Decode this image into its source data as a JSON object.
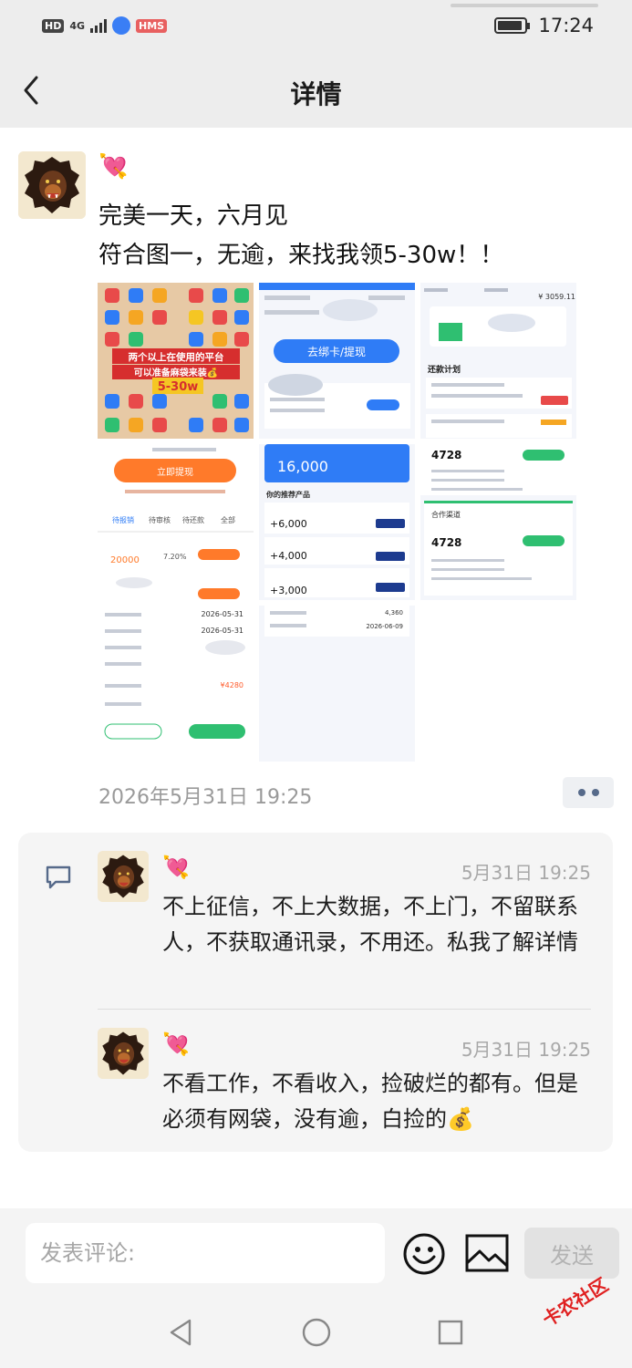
{
  "status_bar": {
    "hd": "HD",
    "network": "4G",
    "hms": "HMS",
    "time": "17:24",
    "icons": [
      "signal-icon",
      "network-icon",
      "battery-icon"
    ]
  },
  "nav": {
    "title": "详情",
    "back_icon": "chevron-left-icon"
  },
  "post": {
    "emoji": "💘",
    "text_line1": "完美一天，六月见",
    "text_line2": "符合图一，无逾，来找我领5-30w！！",
    "timestamp": "2026年5月31日 19:25",
    "images": {
      "img1_overlay1": "两个以上在使用的平台",
      "img1_overlay2": "可以准备麻袋来装💰",
      "img1_overlay3": "5-30w",
      "img2_button": "去绑卡/提现",
      "img3_title": "还款计划",
      "img3_amount1": "¥ 3059.11",
      "img4_button": "立即提现",
      "img4_tabs": [
        "待报销",
        "待审核",
        "待还款",
        "全部"
      ],
      "img4_amount": "20000",
      "img4_rate": "7.20%",
      "img5_amount": "16,000",
      "img5_items": [
        "+6,000",
        "+4,000",
        "+3,000"
      ],
      "img5_header": "你的推荐产品",
      "img6_amount": "4728",
      "img6_subtitle": "合作渠道",
      "img7_date1": "2026-05-31",
      "img7_date2": "2026-05-31",
      "img7_price": "¥4280",
      "img8_amount": "4,360",
      "img8_date": "2026-06-09"
    }
  },
  "comments": [
    {
      "emoji": "💘",
      "time": "5月31日 19:25",
      "text": "不上征信，不上大数据，不上门，不留联系人，不获取通讯录，不用还。私我了解详情"
    },
    {
      "emoji": "💘",
      "time": "5月31日 19:25",
      "text": "不看工作，不看收入，捡破烂的都有。但是必须有网袋，没有逾，白捡的💰"
    }
  ],
  "composer": {
    "placeholder": "发表评论:",
    "send_label": "发送",
    "icons": [
      "emoji-icon",
      "image-icon"
    ]
  },
  "system_nav": {
    "icons": [
      "back-triangle-icon",
      "home-circle-icon",
      "recents-square-icon"
    ]
  },
  "watermark": "卡农社区",
  "colors": {
    "accent_blue": "#2f7cf6",
    "accent_orange": "#ff7a2a",
    "accent_green": "#2fbf71",
    "heart_pink": "#ff4f9a"
  }
}
